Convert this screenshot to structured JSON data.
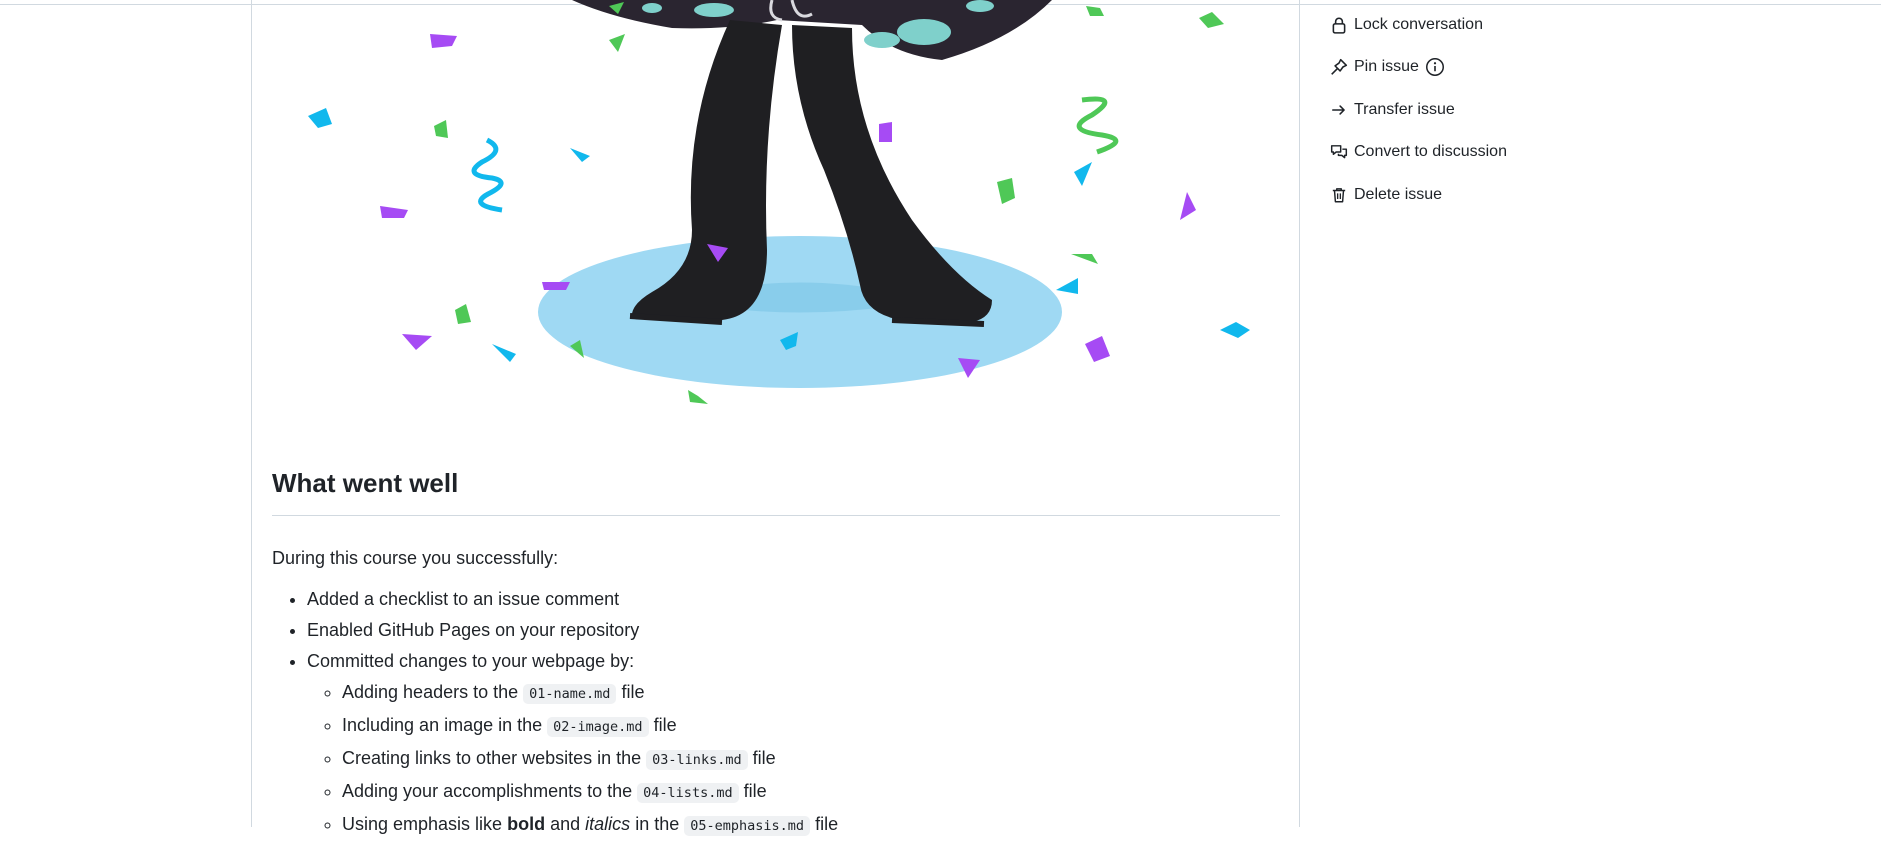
{
  "sidebar": {
    "items": [
      {
        "label": "Lock conversation",
        "icon": "lock-icon"
      },
      {
        "label": "Pin issue",
        "icon": "pin-icon",
        "extra_icon": "info-icon"
      },
      {
        "label": "Transfer issue",
        "icon": "arrow-right-icon"
      },
      {
        "label": "Convert to discussion",
        "icon": "comment-discussion-icon"
      },
      {
        "label": "Delete issue",
        "icon": "trash-icon"
      }
    ]
  },
  "content": {
    "heading": "What went well",
    "intro": "During this course you successfully:",
    "list": [
      "Added a checklist to an issue comment",
      "Enabled GitHub Pages on your repository",
      "Committed changes to your webpage by:"
    ],
    "sublist": [
      {
        "before": "Adding headers to the",
        "code": "01-name.md",
        "after": "file"
      },
      {
        "before": "Including an image in the",
        "code": "02-image.md",
        "after": "file"
      },
      {
        "before": "Creating links to other websites in the",
        "code": "03-links.md",
        "after": "file"
      },
      {
        "before": "Adding your accomplishments to the",
        "code": "04-lists.md",
        "after": "file"
      },
      {
        "before": "Using emphasis like",
        "bold": "bold",
        "and": "and",
        "italic": "italics",
        "in_the": "in the",
        "code": "05-emphasis.md",
        "after": "file"
      }
    ]
  },
  "colors": {
    "confetti_green": "#4fc857",
    "confetti_purple": "#a64bf4",
    "confetti_blue": "#11b8ed",
    "floor": "#9fd9f3",
    "figure": "#1f1f22"
  }
}
